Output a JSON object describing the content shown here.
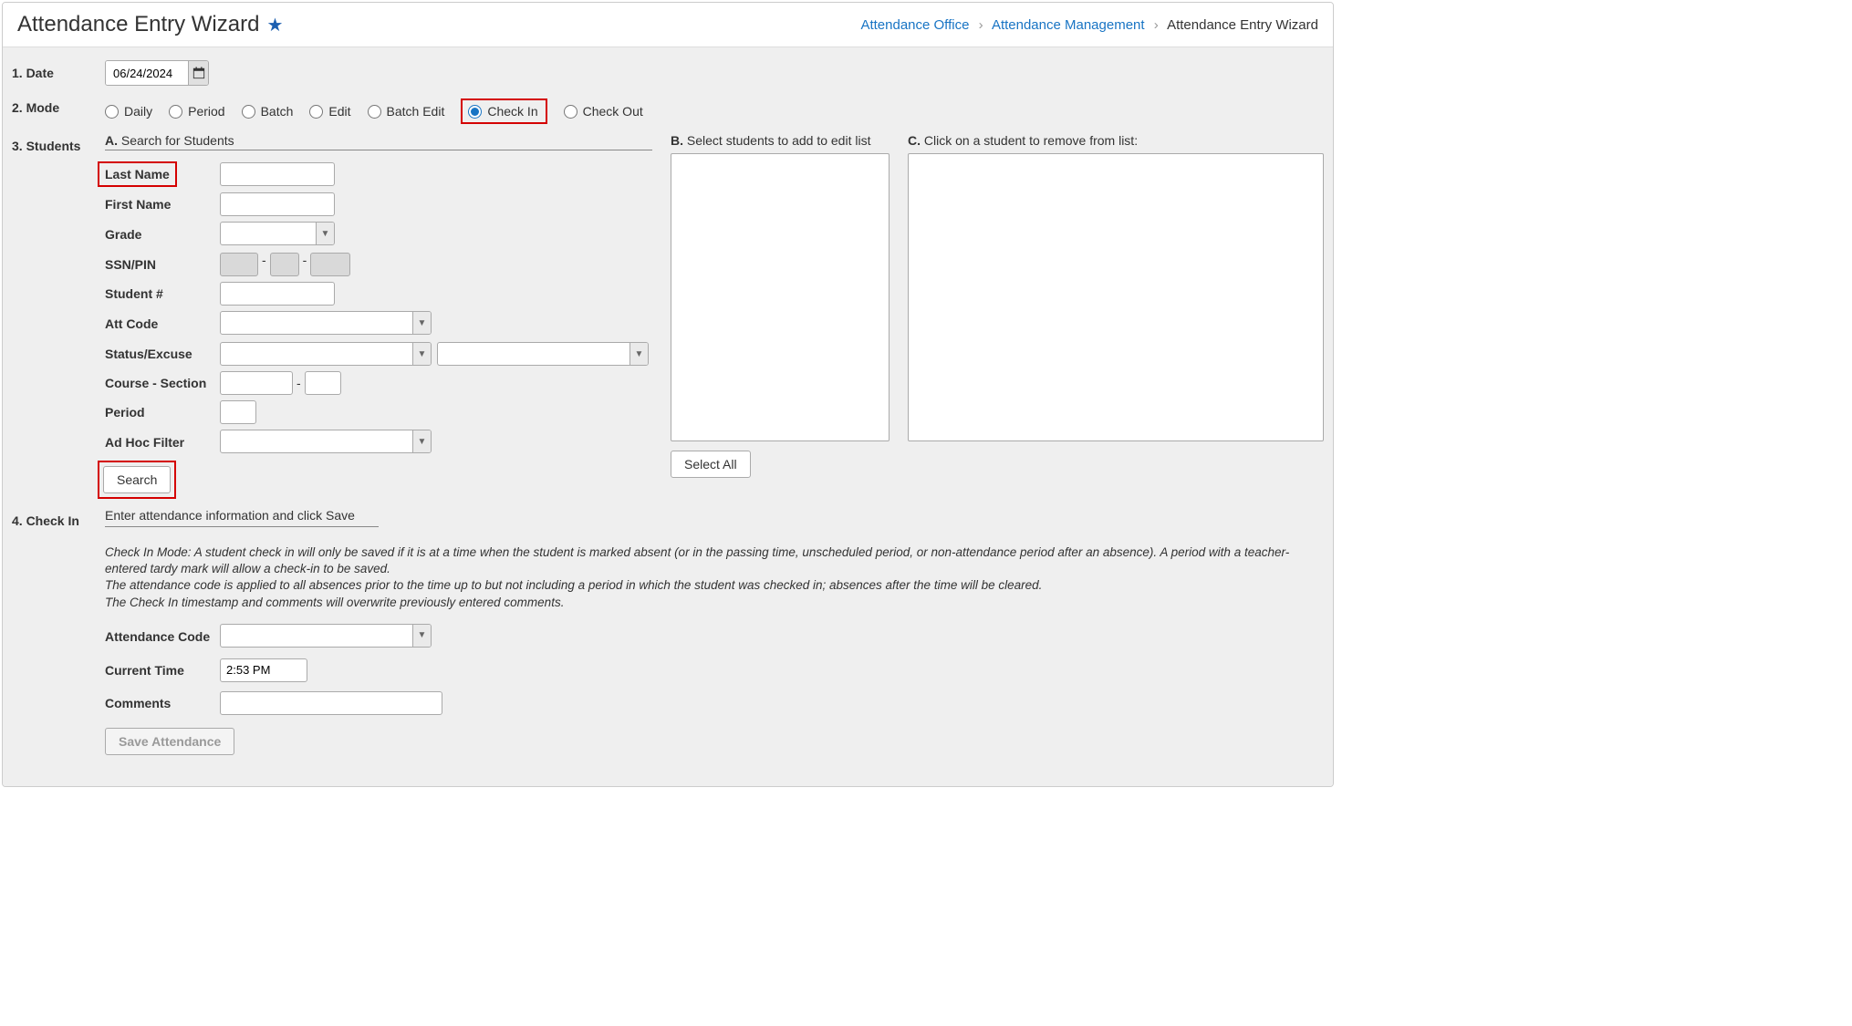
{
  "header": {
    "title": "Attendance Entry Wizard",
    "breadcrumb": {
      "link1": "Attendance Office",
      "link2": "Attendance Management",
      "current": "Attendance Entry Wizard"
    }
  },
  "steps": {
    "date_label": "1. Date",
    "mode_label": "2. Mode",
    "students_label": "3. Students",
    "checkin_label": "4. Check In"
  },
  "date": {
    "value": "06/24/2024"
  },
  "mode": {
    "options": {
      "daily": "Daily",
      "period": "Period",
      "batch": "Batch",
      "edit": "Edit",
      "batch_edit": "Batch Edit",
      "check_in": "Check In",
      "check_out": "Check Out"
    },
    "selected": "check_in"
  },
  "students": {
    "colA_head_prefix": "A.",
    "colA_head": "Search for Students",
    "colB_head_prefix": "B.",
    "colB_head": "Select students to add to edit list",
    "colC_head_prefix": "C.",
    "colC_head": "Click on a student to remove from list:",
    "labels": {
      "last_name": "Last Name",
      "first_name": "First Name",
      "grade": "Grade",
      "ssn_pin": "SSN/PIN",
      "student_no": "Student #",
      "att_code": "Att Code",
      "status_excuse": "Status/Excuse",
      "course_section": "Course - Section",
      "period": "Period",
      "ad_hoc": "Ad Hoc Filter"
    },
    "search_btn": "Search",
    "select_all_btn": "Select All"
  },
  "checkin": {
    "subhead": "Enter attendance information and click Save",
    "info_line1": "Check In Mode: A student check in will only be saved if it is at a time when the student is marked absent (or in the passing time, unscheduled period, or non-attendance period after an absence). A period with a teacher-entered tardy mark will allow a check-in to be saved.",
    "info_line2": "The attendance code is applied to all absences prior to the time up to but not including a period in which the student was checked in; absences after the time will be cleared.",
    "info_line3": "The Check In timestamp and comments will overwrite previously entered comments.",
    "labels": {
      "att_code": "Attendance Code",
      "current_time": "Current Time",
      "comments": "Comments"
    },
    "current_time_value": "2:53 PM",
    "save_btn": "Save Attendance"
  }
}
